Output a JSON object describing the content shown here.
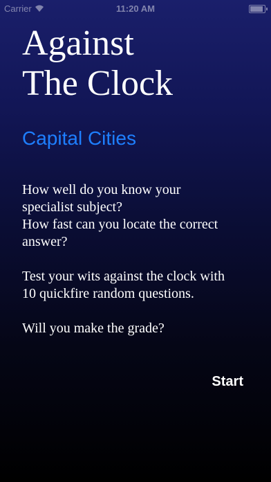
{
  "status_bar": {
    "carrier": "Carrier",
    "time": "11:20 AM",
    "wifi_icon": "wifi-icon",
    "battery_icon": "battery-icon"
  },
  "title_line1": "Against",
  "title_line2": "The Clock",
  "subtitle": "Capital Cities",
  "intro": {
    "line1": "How well do you know your",
    "line2": "specialist subject?",
    "line3": "How fast can you locate the correct",
    "line4": "answer?",
    "line5": "Test your wits against the clock with",
    "line6": "10 quickfire random questions.",
    "line7": "Will you make the grade?"
  },
  "start_label": "Start",
  "colors": {
    "accent": "#1e7fff",
    "background_top": "#1a1f6b",
    "background_bottom": "#000000",
    "text": "#ffffff"
  }
}
